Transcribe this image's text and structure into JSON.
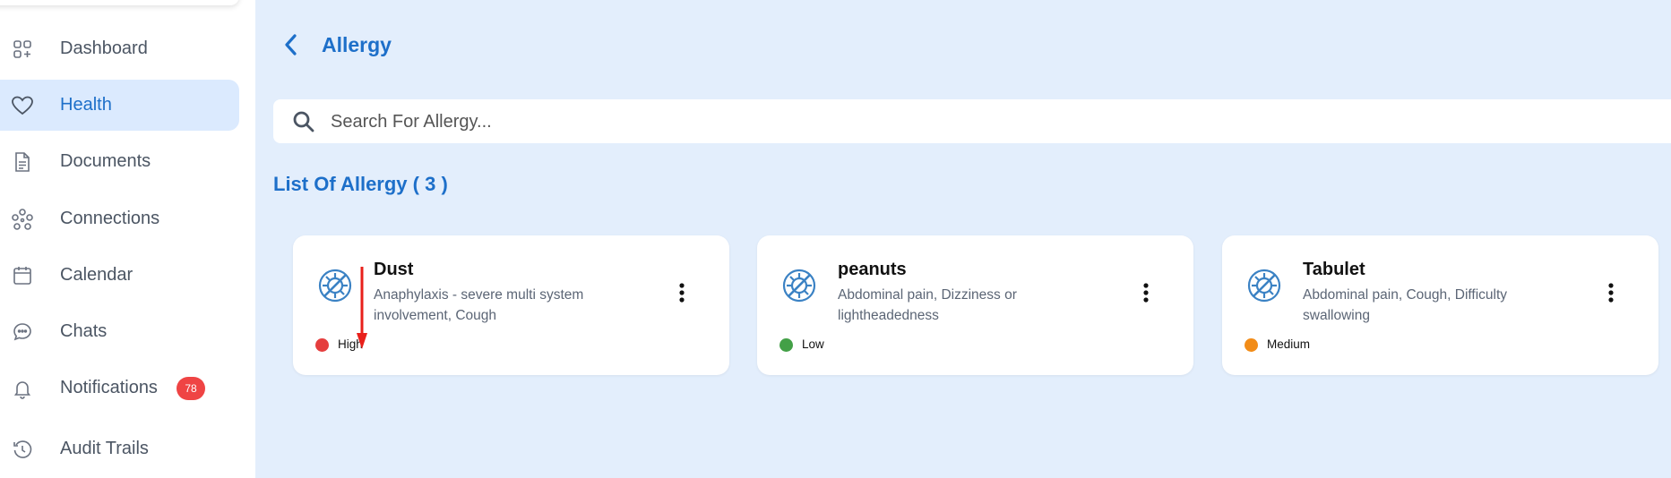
{
  "sidebar": {
    "items": [
      {
        "label": "Dashboard",
        "icon": "dashboard-icon",
        "active": false
      },
      {
        "label": "Health",
        "icon": "heart-icon",
        "active": true
      },
      {
        "label": "Documents",
        "icon": "document-icon",
        "active": false
      },
      {
        "label": "Connections",
        "icon": "connections-icon",
        "active": false
      },
      {
        "label": "Calendar",
        "icon": "calendar-icon",
        "active": false
      },
      {
        "label": "Chats",
        "icon": "chat-icon",
        "active": false
      },
      {
        "label": "Notifications",
        "icon": "bell-icon",
        "active": false,
        "badge": "78"
      },
      {
        "label": "Audit Trails",
        "icon": "history-icon",
        "active": false
      }
    ]
  },
  "header": {
    "title": "Allergy"
  },
  "search": {
    "placeholder": "Search For Allergy..."
  },
  "list": {
    "heading": "List Of Allergy",
    "count_text": "( 3 )"
  },
  "allergies": [
    {
      "name": "Dust",
      "description": "Anaphylaxis - severe multi system involvement, Cough",
      "severity": "High",
      "severity_color": "#e53e3e"
    },
    {
      "name": "peanuts",
      "description": "Abdominal pain, Dizziness or lightheadedness",
      "severity": "Low",
      "severity_color": "#43a047"
    },
    {
      "name": "Tabulet",
      "description": "Abdominal pain, Cough, Difficulty swallowing",
      "severity": "Medium",
      "severity_color": "#f28c18"
    }
  ],
  "colors": {
    "accent": "#1d6fc9",
    "background": "#e3eefc",
    "badge": "#ef4444",
    "annotation": "#e8201b"
  }
}
